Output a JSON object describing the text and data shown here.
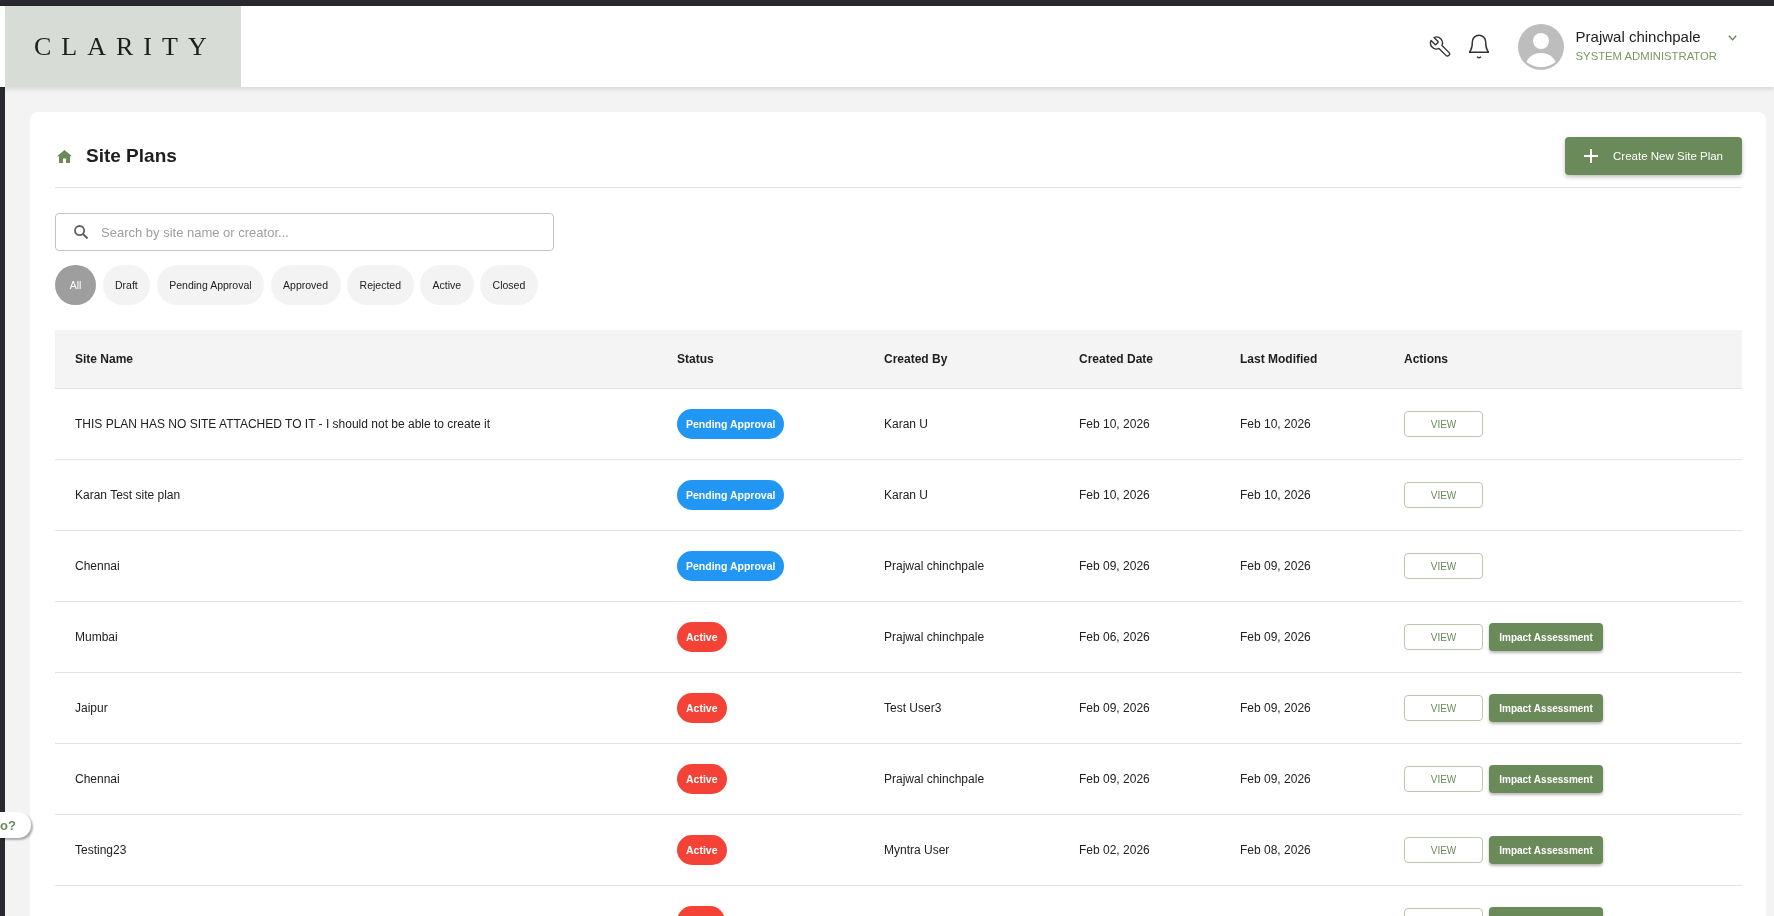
{
  "header": {
    "logo": "CLARITY",
    "user": {
      "name": "Prajwal chinchpale",
      "role": "SYSTEM ADMINISTRATOR"
    }
  },
  "page": {
    "title": "Site Plans",
    "create_button": "Create New Site Plan"
  },
  "search": {
    "placeholder": "Search by site name or creator..."
  },
  "filters": [
    {
      "label": "All",
      "selected": true
    },
    {
      "label": "Draft",
      "selected": false
    },
    {
      "label": "Pending Approval",
      "selected": false
    },
    {
      "label": "Approved",
      "selected": false
    },
    {
      "label": "Rejected",
      "selected": false
    },
    {
      "label": "Active",
      "selected": false
    },
    {
      "label": "Closed",
      "selected": false
    }
  ],
  "table": {
    "columns": [
      "Site Name",
      "Status",
      "Created By",
      "Created Date",
      "Last Modified",
      "Actions"
    ],
    "rows": [
      {
        "site_name": "THIS PLAN HAS NO SITE ATTACHED TO IT - I should not be able to create it",
        "status": {
          "label": "Pending Approval",
          "color": "#2196f3"
        },
        "created_by": "Karan U",
        "created_date": "Feb 10, 2026",
        "last_modified": "Feb 10, 2026",
        "actions": [
          {
            "kind": "outline",
            "label": "VIEW"
          }
        ]
      },
      {
        "site_name": "Karan Test site plan",
        "status": {
          "label": "Pending Approval",
          "color": "#2196f3"
        },
        "created_by": "Karan U",
        "created_date": "Feb 10, 2026",
        "last_modified": "Feb 10, 2026",
        "actions": [
          {
            "kind": "outline",
            "label": "VIEW"
          }
        ]
      },
      {
        "site_name": "Chennai",
        "status": {
          "label": "Pending Approval",
          "color": "#2196f3"
        },
        "created_by": "Prajwal chinchpale",
        "created_date": "Feb 09, 2026",
        "last_modified": "Feb 09, 2026",
        "actions": [
          {
            "kind": "outline",
            "label": "VIEW"
          }
        ]
      },
      {
        "site_name": "Mumbai",
        "status": {
          "label": "Active",
          "color": "#f44336"
        },
        "created_by": "Prajwal chinchpale",
        "created_date": "Feb 06, 2026",
        "last_modified": "Feb 09, 2026",
        "actions": [
          {
            "kind": "outline",
            "label": "VIEW"
          },
          {
            "kind": "filled",
            "label": "Impact Assessment"
          }
        ]
      },
      {
        "site_name": "Jaipur",
        "status": {
          "label": "Active",
          "color": "#f44336"
        },
        "created_by": "Test User3",
        "created_date": "Feb 09, 2026",
        "last_modified": "Feb 09, 2026",
        "actions": [
          {
            "kind": "outline",
            "label": "VIEW"
          },
          {
            "kind": "filled",
            "label": "Impact Assessment"
          }
        ]
      },
      {
        "site_name": "Chennai",
        "status": {
          "label": "Active",
          "color": "#f44336"
        },
        "created_by": "Prajwal chinchpale",
        "created_date": "Feb 09, 2026",
        "last_modified": "Feb 09, 2026",
        "actions": [
          {
            "kind": "outline",
            "label": "VIEW"
          },
          {
            "kind": "filled",
            "label": "Impact Assessment"
          }
        ]
      },
      {
        "site_name": "Testing23",
        "status": {
          "label": "Active",
          "color": "#f44336"
        },
        "created_by": "Myntra User",
        "created_date": "Feb 02, 2026",
        "last_modified": "Feb 08, 2026",
        "actions": [
          {
            "kind": "outline",
            "label": "VIEW"
          },
          {
            "kind": "filled",
            "label": "Impact Assessment"
          }
        ]
      },
      {
        "status": {
          "color": "#f44336"
        },
        "actions": [
          {
            "kind": "outline"
          },
          {
            "kind": "filled"
          }
        ]
      }
    ]
  },
  "help_tab": {
    "label": "o?"
  }
}
